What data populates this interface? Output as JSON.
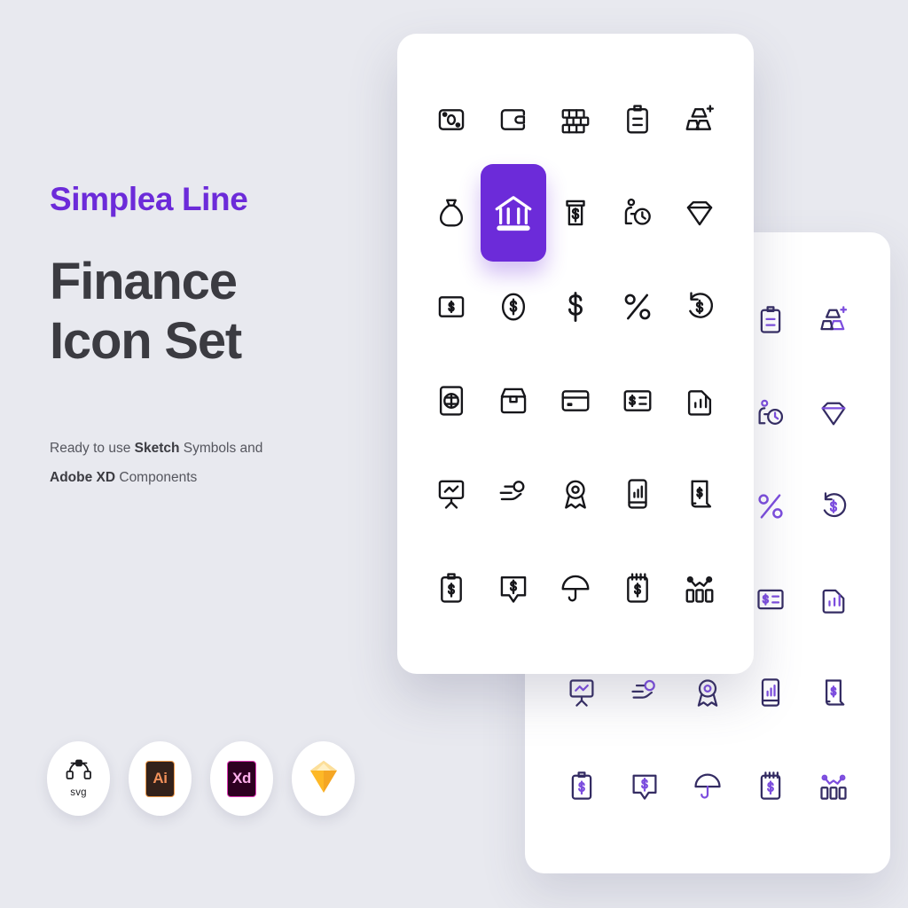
{
  "background_color": "#e8e9ef",
  "accent_color": "#6c2bd9",
  "heading_color": "#3b3b41",
  "hero": {
    "eyebrow": "Simplea Line",
    "title": "Finance Icon Set",
    "subtitle_line1_prefix": "Ready to use ",
    "subtitle_line1_bold": "Sketch",
    "subtitle_line1_suffix": " Symbols and",
    "subtitle_line2_bold": "Adobe XD",
    "subtitle_line2_suffix": " Components"
  },
  "format_badges": [
    {
      "name": "svg-badge",
      "label": "svg",
      "icon": "bezier-pen-icon"
    },
    {
      "name": "illustrator-badge",
      "label": "Ai",
      "icon": "adobe-illustrator-icon"
    },
    {
      "name": "adobe-xd-badge",
      "label": "Xd",
      "icon": "adobe-xd-icon"
    },
    {
      "name": "sketch-badge",
      "label": "",
      "icon": "sketch-diamond-icon"
    }
  ],
  "front_card": {
    "name": "front-icon-card",
    "icon_color": "#16161a",
    "selected_index": 6,
    "selected_bg": "#6c2bd9",
    "icons": [
      "safe-box-icon",
      "wallet-icon",
      "money-stack-icon",
      "clipboard-list-icon",
      "gold-bars-plus-icon",
      "money-bag-icon",
      "bank-building-icon",
      "atm-cash-icon",
      "person-clock-icon",
      "diamond-gem-icon",
      "banknote-square-icon",
      "dollar-coin-icon",
      "dollar-sign-icon",
      "percent-icon",
      "refund-rotate-icon",
      "piggy-card-icon",
      "cash-box-icon",
      "credit-card-icon",
      "invoice-list-icon",
      "chart-file-icon",
      "presentation-chart-icon",
      "hand-coin-icon",
      "award-ribbon-icon",
      "mobile-chart-icon",
      "receipt-scroll-icon",
      "clipboard-dollar-icon",
      "chat-dollar-icon",
      "umbrella-icon",
      "notepad-dollar-icon",
      "analytics-bars-icon"
    ]
  },
  "back_card": {
    "name": "back-icon-card",
    "icon_color": "#342c63",
    "accent_color": "#7c4dde",
    "icons": [
      "safe-box-icon",
      "wallet-icon",
      "money-stack-icon",
      "clipboard-list-icon",
      "gold-bars-plus-icon",
      "money-bag-icon",
      "bank-building-icon",
      "atm-cash-icon",
      "person-clock-icon",
      "diamond-gem-icon",
      "banknote-square-icon",
      "dollar-coin-icon",
      "dollar-sign-icon",
      "percent-icon",
      "refund-rotate-icon",
      "piggy-card-icon",
      "cash-box-icon",
      "credit-card-icon",
      "invoice-list-icon",
      "chart-file-icon",
      "presentation-chart-icon",
      "hand-coin-icon",
      "award-ribbon-icon",
      "mobile-chart-icon",
      "receipt-scroll-icon",
      "clipboard-dollar-icon",
      "chat-dollar-icon",
      "umbrella-icon",
      "notepad-dollar-icon",
      "analytics-bars-icon"
    ]
  }
}
